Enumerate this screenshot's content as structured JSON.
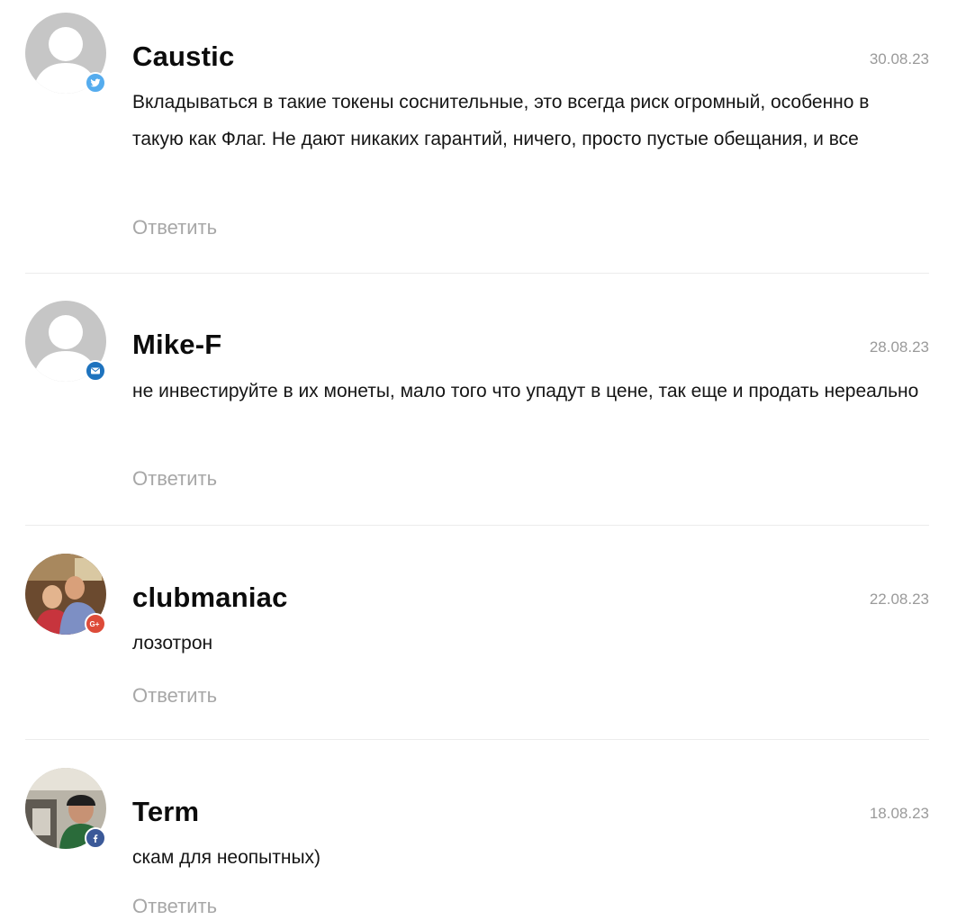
{
  "comments": [
    {
      "author": "Caustic",
      "date": "30.08.23",
      "text": "Вкладываться в такие токены соснительные, это всегда риск огромный, особенно в такую как Флаг. Не дают никаких гарантий, ничего, просто пустые обещания, и все",
      "reply_label": "Ответить",
      "avatar": "default-avatar-icon",
      "network": "twitter-icon",
      "network_color": "#55acee"
    },
    {
      "author": "Mike-F",
      "date": "28.08.23",
      "text": "не инвестируйте в их монеты, мало того что упадут в цене, так еще и продать нереально",
      "reply_label": "Ответить",
      "avatar": "default-avatar-icon",
      "network": "mail-icon",
      "network_color": "#1e73be"
    },
    {
      "author": "clubmaniac",
      "date": "22.08.23",
      "text": "лозотрон",
      "reply_label": "Ответить",
      "avatar": "user-photo",
      "network": "google-plus-icon",
      "network_color": "#dd4b39"
    },
    {
      "author": "Term",
      "date": "18.08.23",
      "text": "скам для неопытных)",
      "reply_label": "Ответить",
      "avatar": "user-photo",
      "network": "facebook-icon",
      "network_color": "#3b5998"
    }
  ]
}
